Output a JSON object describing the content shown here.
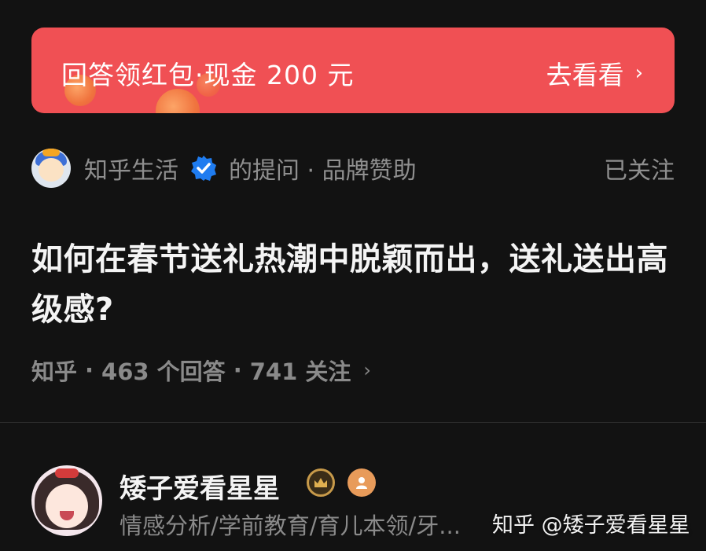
{
  "banner": {
    "text": "回答领红包·现金 200 元",
    "cta": "去看看",
    "color": "#f05054"
  },
  "asker": {
    "name": "知乎生活",
    "suffix": "的提问 · 品牌赞助",
    "follow_status": "已关注",
    "verified_icon": "verified-check-icon"
  },
  "question": {
    "title": "如何在春节送礼热潮中脱颖而出，送礼送出高级感?",
    "stats": {
      "source": "知乎",
      "answers": "463 个回答",
      "follows": "741 关注"
    }
  },
  "answerer": {
    "name": "矮子爱看星星",
    "bio": "情感分析/学前教育/育儿本领/牙...",
    "badges": [
      "crown-badge-icon",
      "person-badge-icon"
    ]
  },
  "watermark": "知乎 @矮子爱看星星"
}
